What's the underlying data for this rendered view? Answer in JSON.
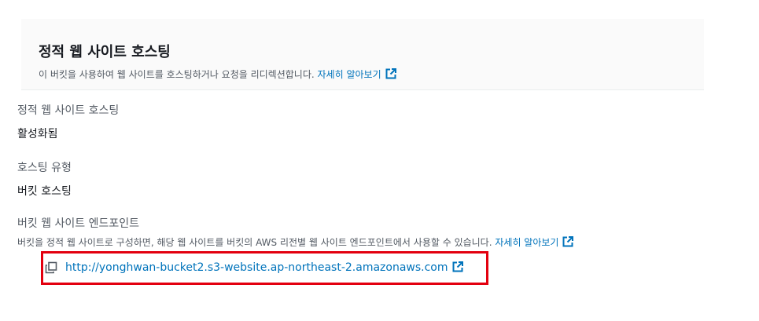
{
  "header": {
    "title": "정적 웹 사이트 호스팅",
    "description": "이 버킷을 사용하여 웹 사이트를 호스팅하거나 요청을 리디렉션합니다.",
    "learn_more": "자세히 알아보기"
  },
  "fields": {
    "static_hosting": {
      "label": "정적 웹 사이트 호스팅",
      "value": "활성화됨"
    },
    "hosting_type": {
      "label": "호스팅 유형",
      "value": "버킷 호스팅"
    },
    "endpoint": {
      "label": "버킷 웹 사이트 엔드포인트",
      "description": "버킷을 정적 웹 사이트로 구성하면, 해당 웹 사이트를 버킷의 AWS 리전별 웹 사이트 엔드포인트에서 사용할 수 있습니다.",
      "learn_more": "자세히 알아보기",
      "url": "http://yonghwan-bucket2.s3-website.ap-northeast-2.amazonaws.com"
    }
  },
  "icons": {
    "external_link": "external-link-icon",
    "copy": "copy-icon"
  },
  "colors": {
    "link": "#0073bb",
    "highlight": "#e3000f",
    "header_bg": "#fafafa"
  }
}
